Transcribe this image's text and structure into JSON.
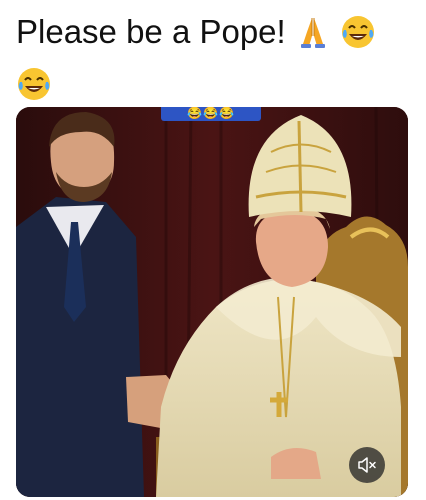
{
  "post": {
    "caption_text": "Please be a Pope!",
    "caption_emojis": [
      "folded-hands-icon",
      "tears-of-joy-icon",
      "tears-of-joy-icon"
    ]
  },
  "media": {
    "type": "video",
    "overlay_strip_emojis": [
      "tears-of-joy-icon",
      "tears-of-joy-icon",
      "tears-of-joy-icon"
    ],
    "overlay_strip_color": "#2d55c4",
    "muted": true,
    "mute_icon": "speaker-muted-icon"
  },
  "colors": {
    "background": "#ffffff",
    "text": "#111111",
    "emoji_yellow": "#f8c531",
    "mitre_cream": "#ece2b8",
    "backdrop_red": "#4a1414"
  }
}
